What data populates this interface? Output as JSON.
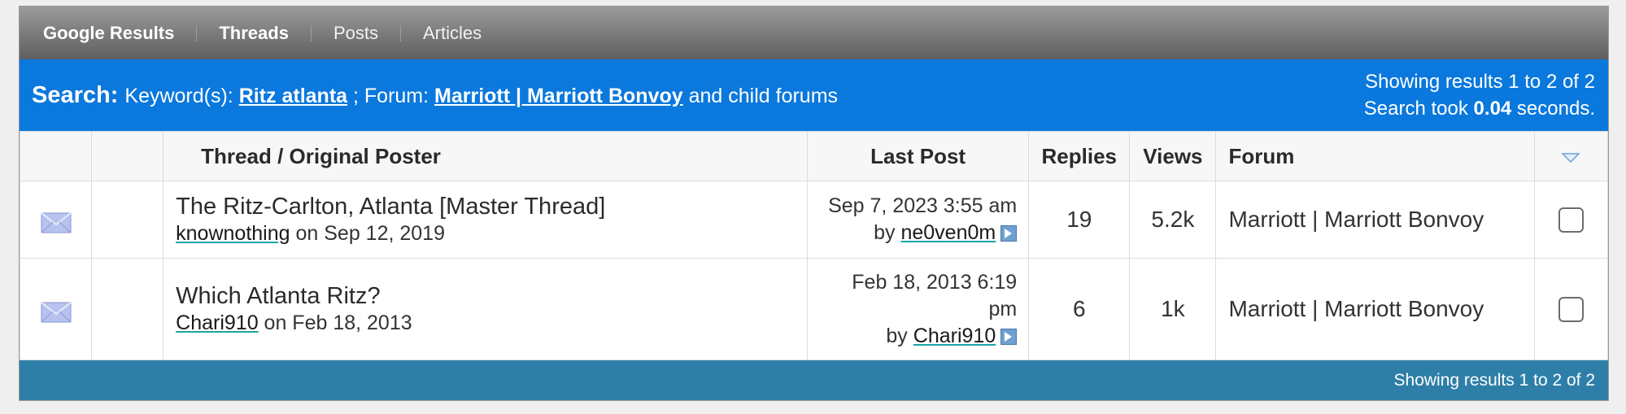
{
  "tabs": [
    {
      "label": "Google Results",
      "bold": true
    },
    {
      "label": "Threads",
      "bold": true
    },
    {
      "label": "Posts",
      "bold": false
    },
    {
      "label": "Articles",
      "bold": false
    }
  ],
  "search": {
    "label": "Search:",
    "keyword_prefix": "Keyword(s): ",
    "keyword": "Ritz atlanta",
    "forum_prefix": " ; Forum: ",
    "forum": "Marriott | Marriott Bonvoy",
    "forum_suffix": " and child forums",
    "results_text": "Showing results 1 to 2 of 2",
    "took_prefix": "Search took ",
    "took_value": "0.04",
    "took_suffix": " seconds."
  },
  "columns": {
    "thread": "Thread / Original Poster",
    "last_post": "Last Post",
    "replies": "Replies",
    "views": "Views",
    "forum": "Forum"
  },
  "rows": [
    {
      "title": "The Ritz-Carlton, Atlanta [Master Thread]",
      "poster": "knownothing",
      "on_text": " on Sep 12, 2019",
      "last_post_date": "Sep 7, 2023 3:55 am",
      "last_by_prefix": "by ",
      "last_by": "ne0ven0m",
      "replies": "19",
      "views": "5.2k",
      "forum": "Marriott | Marriott Bonvoy"
    },
    {
      "title": "Which Atlanta Ritz?",
      "poster": "Chari910",
      "on_text": " on Feb 18, 2013",
      "last_post_date_line1": "Feb 18, 2013 6:19",
      "last_post_date_line2": "pm",
      "last_by_prefix": "by ",
      "last_by": "Chari910",
      "replies": "6",
      "views": "1k",
      "forum": "Marriott | Marriott Bonvoy"
    }
  ],
  "footer": {
    "results_text": "Showing results 1 to 2 of 2"
  },
  "colors": {
    "search_bar": "#0a78dc",
    "footer": "#2e7fa8",
    "tab_bar": "#7f7f7f"
  },
  "icons": [
    "envelope-icon",
    "goto-post-icon",
    "sort-triangle-icon"
  ]
}
